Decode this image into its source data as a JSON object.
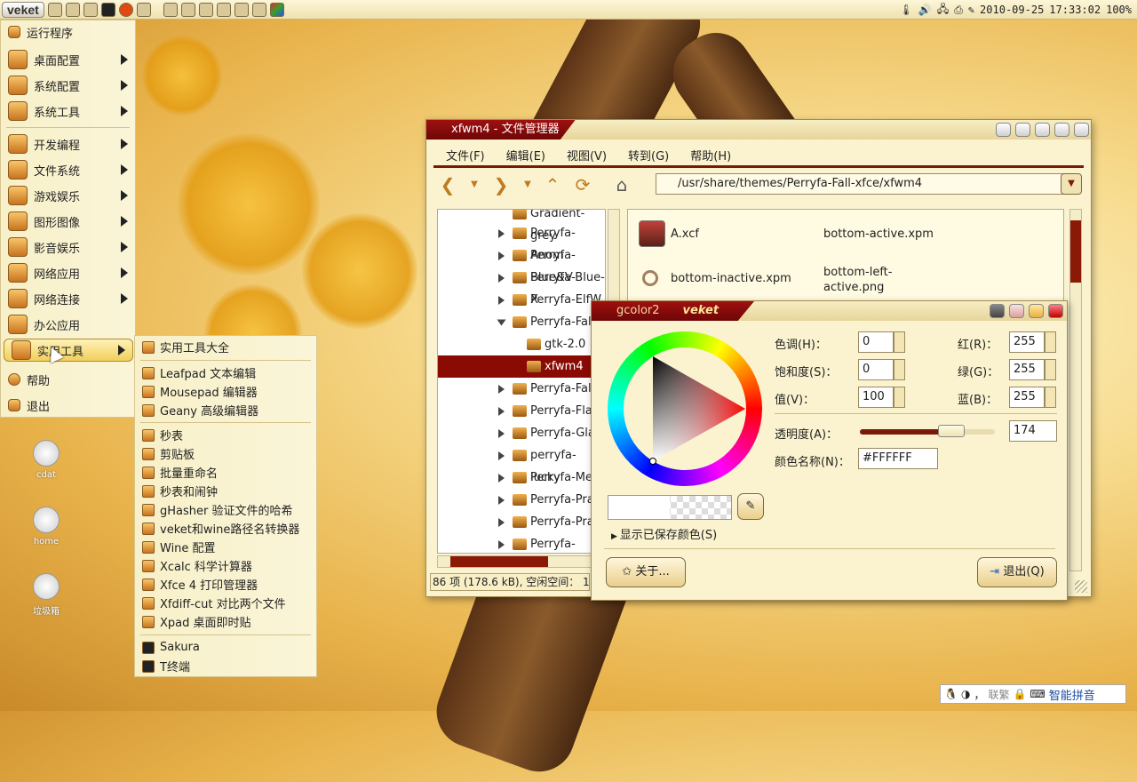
{
  "panel": {
    "logo": "veket",
    "date": "2010-09-25",
    "time": "17:33:02",
    "battery": "100%"
  },
  "menu": {
    "items": [
      {
        "label": "运行程序"
      },
      {
        "label": "桌面配置"
      },
      {
        "label": "系统配置"
      },
      {
        "label": "系统工具"
      },
      {
        "label": "开发编程"
      },
      {
        "label": "文件系统"
      },
      {
        "label": "游戏娱乐"
      },
      {
        "label": "图形图像"
      },
      {
        "label": "影音娱乐"
      },
      {
        "label": "网络应用"
      },
      {
        "label": "网络连接"
      },
      {
        "label": "办公应用"
      },
      {
        "label": "实用工具"
      },
      {
        "label": "帮助"
      },
      {
        "label": "退出"
      }
    ]
  },
  "submenu": {
    "items": [
      {
        "label": "实用工具大全"
      },
      {
        "label": "Leafpad 文本编辑"
      },
      {
        "label": "Mousepad 编辑器"
      },
      {
        "label": "Geany 高级编辑器"
      },
      {
        "label": "秒表"
      },
      {
        "label": "剪贴板"
      },
      {
        "label": "批量重命名"
      },
      {
        "label": "秒表和闹钟"
      },
      {
        "label": "gHasher 验证文件的哈希"
      },
      {
        "label": "veket和wine路径名转换器"
      },
      {
        "label": "Wine 配置"
      },
      {
        "label": "Xcalc 科学计算器"
      },
      {
        "label": "Xfce 4 打印管理器"
      },
      {
        "label": "Xfdiff-cut 对比两个文件"
      },
      {
        "label": "Xpad 桌面即时贴"
      },
      {
        "label": "Sakura"
      },
      {
        "label": "T终端"
      }
    ]
  },
  "desktop_icons": [
    "cdat",
    "home",
    "垃圾箱"
  ],
  "filemanager": {
    "title": "xfwm4 - 文件管理器",
    "menu": [
      "文件(F)",
      "编辑(E)",
      "视图(V)",
      "转到(G)",
      "帮助(H)"
    ],
    "path": "/usr/share/themes/Perryfa-Fall-xfce/xfwm4",
    "tree": [
      "Gradient-grey",
      "Perryfa-Anom",
      "Perryfa-Blue&V",
      "Perryfa-Blue-X",
      "Perryfa-ElfW",
      "Perryfa-Fall-",
      "gtk-2.0",
      "xfwm4",
      "Perryfa-Fall1",
      "Perryfa-Flam",
      "Perryfa-Glas",
      "perryfa-lucky",
      "Perryfa-Meta",
      "Perryfa-Prac",
      "Perryfa-Prac",
      "Perryfa-rainb"
    ],
    "files": [
      {
        "name": "A.xcf"
      },
      {
        "name": "bottom-active.xpm"
      },
      {
        "name": "bottom-inactive.xpm"
      },
      {
        "name": "bottom-left-active.png"
      }
    ],
    "status": "86 项 (178.6 kB), 空闲空间： 12"
  },
  "gcolor2": {
    "title": "gcolor2",
    "brand": "veket",
    "hue_label": "色调(H)：",
    "hue": "0",
    "sat_label": "饱和度(S)：",
    "sat": "0",
    "val_label": "值(V)：",
    "val": "100",
    "red_label": "红(R)：",
    "red": "255",
    "green_label": "绿(G)：",
    "green": "255",
    "blue_label": "蓝(B)：",
    "blue": "255",
    "opacity_label": "透明度(A)：",
    "opacity": "174",
    "opacity_fraction": 0.68,
    "name_label": "颜色名称(N)：",
    "name": "#FFFFFF",
    "saved": "显示已保存颜色(S)",
    "about": "关于...",
    "quit": "退出(Q)"
  },
  "tray": {
    "ime": "智能拼音",
    "ime_chars": "联繁"
  },
  "colors": {
    "accent": "#8a0a04",
    "menubg": "#f7f0c8"
  }
}
